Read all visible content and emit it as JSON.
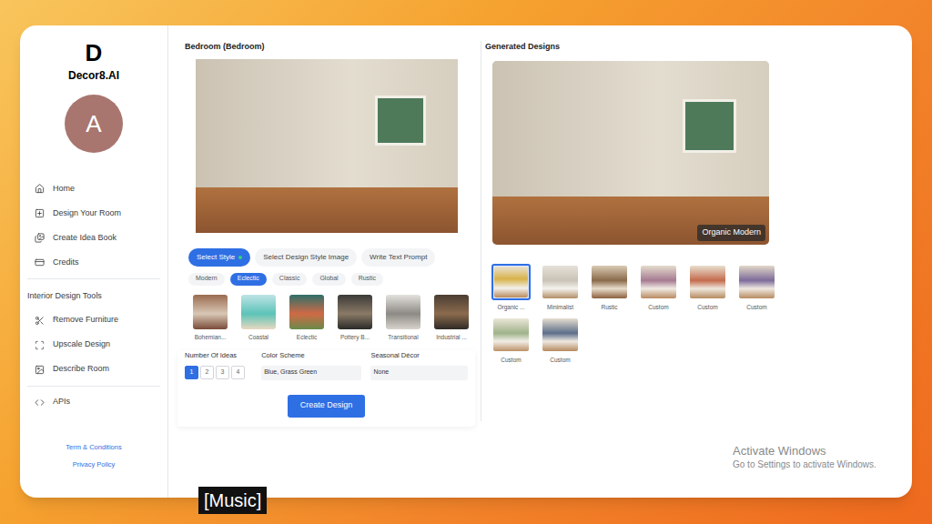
{
  "app": {
    "logo_letter": "D",
    "name": "Decor8.AI",
    "avatar_letter": "A"
  },
  "sidebar": {
    "nav": [
      {
        "label": "Home",
        "selected": false
      },
      {
        "label": "Design Your Room",
        "selected": false
      },
      {
        "label": "Create Idea Book",
        "selected": false
      },
      {
        "label": "Credits",
        "selected": false
      }
    ],
    "tools_title": "Interior Design Tools",
    "tools": [
      {
        "label": "Remove Furniture",
        "selected": false
      },
      {
        "label": "Upscale Design",
        "selected": false
      },
      {
        "label": "Describe Room",
        "selected": false
      }
    ],
    "extra": [
      {
        "label": "APIs",
        "selected": false
      }
    ],
    "footer_links": [
      "Term & Conditions",
      "Privacy Policy"
    ]
  },
  "room": {
    "title": "Bedroom (Bedroom)"
  },
  "input_tabs": [
    {
      "label": "Select Style",
      "selected": true
    },
    {
      "label": "Select Design Style Image",
      "selected": false
    },
    {
      "label": "Write Text Prompt",
      "selected": false
    }
  ],
  "style_categories": [
    {
      "label": "Modern",
      "selected": false
    },
    {
      "label": "Eclectic",
      "selected": true
    },
    {
      "label": "Classic",
      "selected": false
    },
    {
      "label": "Global",
      "selected": false
    },
    {
      "label": "Rustic",
      "selected": false
    }
  ],
  "styles": [
    {
      "label": "Bohemian..."
    },
    {
      "label": "Coastal"
    },
    {
      "label": "Eclectic"
    },
    {
      "label": "Pottery B..."
    },
    {
      "label": "Transitional"
    },
    {
      "label": "Industrial ..."
    }
  ],
  "number_of_ideas": {
    "label": "Number Of Ideas",
    "options": [
      {
        "label": "1",
        "selected": true
      },
      {
        "label": "2",
        "selected": false
      },
      {
        "label": "3",
        "selected": false
      },
      {
        "label": "4",
        "selected": false
      }
    ]
  },
  "color_scheme": {
    "label": "Color Scheme",
    "value": "Blue, Grass Green"
  },
  "seasonal_decor": {
    "label": "Seasonal Décor",
    "value": "None"
  },
  "create_button": "Create Design",
  "generated": {
    "title": "Generated Designs",
    "badge": "Organic Modern",
    "thumbnails": [
      {
        "label": "Organic ...",
        "selected": true
      },
      {
        "label": "Minimalist",
        "selected": false
      },
      {
        "label": "Rustic",
        "selected": false
      },
      {
        "label": "Custom",
        "selected": false
      },
      {
        "label": "Custom",
        "selected": false
      },
      {
        "label": "Custom",
        "selected": false
      },
      {
        "label": "Custom",
        "selected": false
      },
      {
        "label": "Custom",
        "selected": false
      }
    ]
  },
  "watermark": {
    "title": "Activate Windows",
    "subtitle": "Go to Settings to activate Windows."
  },
  "caption": "[Music]"
}
